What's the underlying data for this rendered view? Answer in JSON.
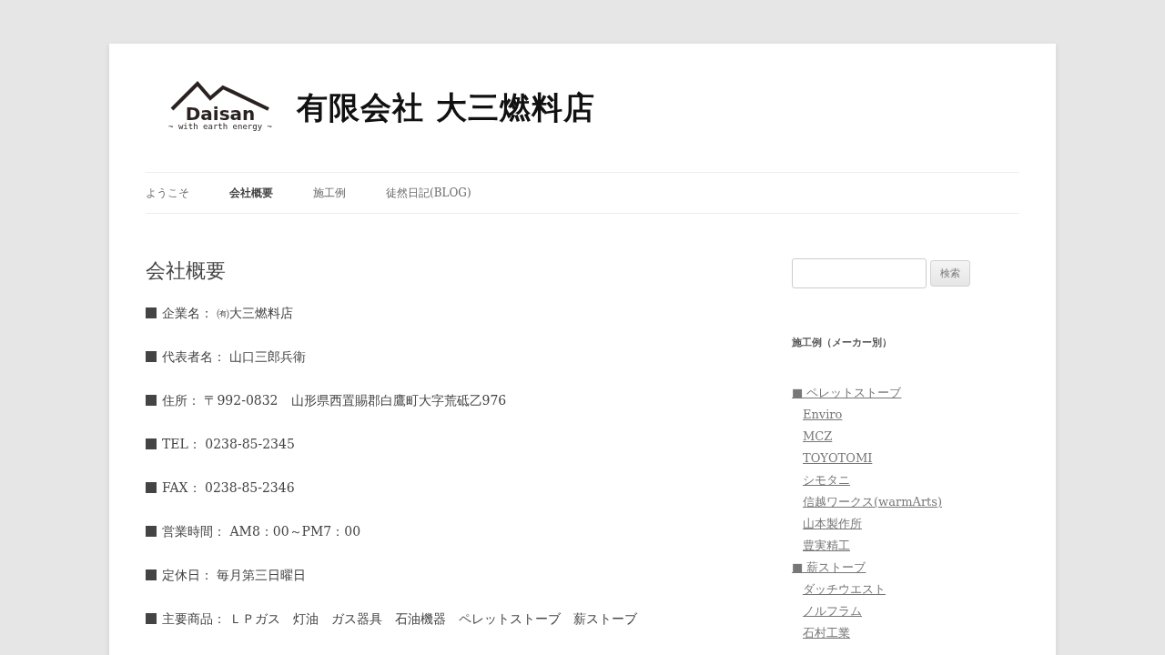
{
  "header": {
    "logo_word": "Daisan",
    "logo_tagline": "~ with earth energy ~",
    "site_title": "有限会社 大三燃料店"
  },
  "nav": [
    {
      "label": "ようこそ",
      "selected": false
    },
    {
      "label": "会社概要",
      "selected": true
    },
    {
      "label": "施工例",
      "selected": false
    },
    {
      "label": "徒然日記(BLOG)",
      "selected": false
    }
  ],
  "page_title": "会社概要",
  "info": [
    {
      "label": "企業名：",
      "value": "㈲大三燃料店"
    },
    {
      "label": "代表者名：",
      "value": "山口三郎兵衛"
    },
    {
      "label": "住所：",
      "value": "〒992-0832　山形県西置賜郡白鷹町大字荒砥乙976"
    },
    {
      "label": "TEL：",
      "value": "0238-85-2345"
    },
    {
      "label": "FAX：",
      "value": "0238-85-2346"
    },
    {
      "label": "営業時間：",
      "value": "AM8：00～PM7：00"
    },
    {
      "label": "定休日：",
      "value": "毎月第三日曜日"
    },
    {
      "label": "主要商品：",
      "value": "ＬＰガス　灯油　ガス器具　石油機器　ペレットストーブ　薪ストーブ"
    }
  ],
  "sidebar": {
    "search_button": "検索",
    "widget_title": "施工例（メーカー別）",
    "categories": [
      {
        "label": "■ ペレットストーブ",
        "children": [
          {
            "label": "Enviro"
          },
          {
            "label": "MCZ"
          },
          {
            "label": "TOYOTOMI"
          },
          {
            "label": "シモタニ"
          },
          {
            "label": "信越ワークス(warmArts)"
          },
          {
            "label": "山本製作所"
          },
          {
            "label": "豊実精工"
          }
        ]
      },
      {
        "label": "■ 薪ストーブ",
        "children": [
          {
            "label": "ダッチウエスト"
          },
          {
            "label": "ノルフラム"
          },
          {
            "label": "石村工業"
          }
        ]
      }
    ]
  }
}
